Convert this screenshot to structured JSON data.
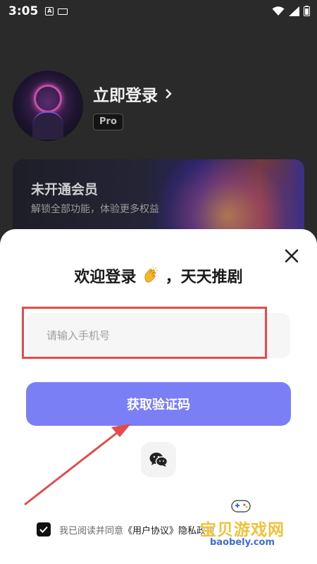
{
  "status_bar": {
    "time": "3:05",
    "ime_label": "A"
  },
  "profile": {
    "login_label": "立即登录",
    "badge": "Pro"
  },
  "vip_card": {
    "title": "未开通会员",
    "subtitle": "解锁全部功能，体验更多权益"
  },
  "login_sheet": {
    "title": "欢迎登录",
    "title_suffix": "，天天推剧",
    "phone_placeholder": "请输入手机号",
    "get_code_label": "获取验证码",
    "agreement_prefix": "我已阅读并同意",
    "agreement_link": "《用户协议》",
    "agreement_tail": "隐私政策"
  },
  "watermark": {
    "name": "宝贝游戏网",
    "domain": "baobely.com"
  },
  "colors": {
    "accent": "#7B7FF5",
    "highlight": "#E44B4B",
    "sheet_bg": "#FFFFFF",
    "overlay": "#2A2A2A"
  },
  "icons": [
    "wifi-icon",
    "signal-icon",
    "battery-icon",
    "close-icon",
    "wechat-icon",
    "checkbox-checked-icon",
    "chevron-right-icon",
    "clap-emoji-icon"
  ]
}
